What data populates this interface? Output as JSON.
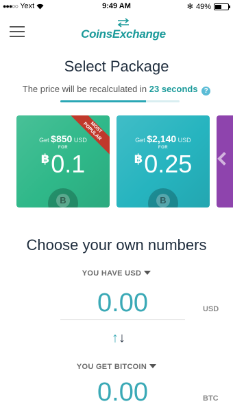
{
  "status_bar": {
    "carrier": "Yext",
    "time": "9:49 AM",
    "bluetooth": "✻",
    "battery": "49%",
    "battery_level": 0.49
  },
  "header": {
    "logo_part1": "Coins",
    "logo_part2": "Exchange",
    "menu_icon": "hamburger-menu-icon"
  },
  "title": "Select Package",
  "recalc": {
    "prefix": "The price will be recalculated in",
    "seconds": "23 seconds",
    "progress": 0.72,
    "help_icon": "?"
  },
  "packages": [
    {
      "get": "Get",
      "amount": "$850",
      "currency": "USD",
      "for": "FOR",
      "btc_sign": "฿",
      "btc_value": "0.1",
      "ribbon_line1": "MOST",
      "ribbon_line2": "POPULAR",
      "color": "#2fb889"
    },
    {
      "get": "Get",
      "amount": "$2,140",
      "currency": "USD",
      "for": "FOR",
      "btc_sign": "฿",
      "btc_value": "0.25",
      "color": "#26b4bf"
    },
    {
      "color": "#8e44ad"
    }
  ],
  "own_numbers": {
    "title": "Choose your own numbers",
    "have_label": "YOU HAVE USD",
    "have_value": "0.00",
    "have_unit": "USD",
    "get_label": "YOU GET BITCOIN",
    "get_value": "0.00",
    "get_unit": "BTC",
    "swap_up": "↑",
    "swap_down": "↓"
  },
  "colors": {
    "accent": "#1a9a9a",
    "value": "#3aa9b6"
  }
}
